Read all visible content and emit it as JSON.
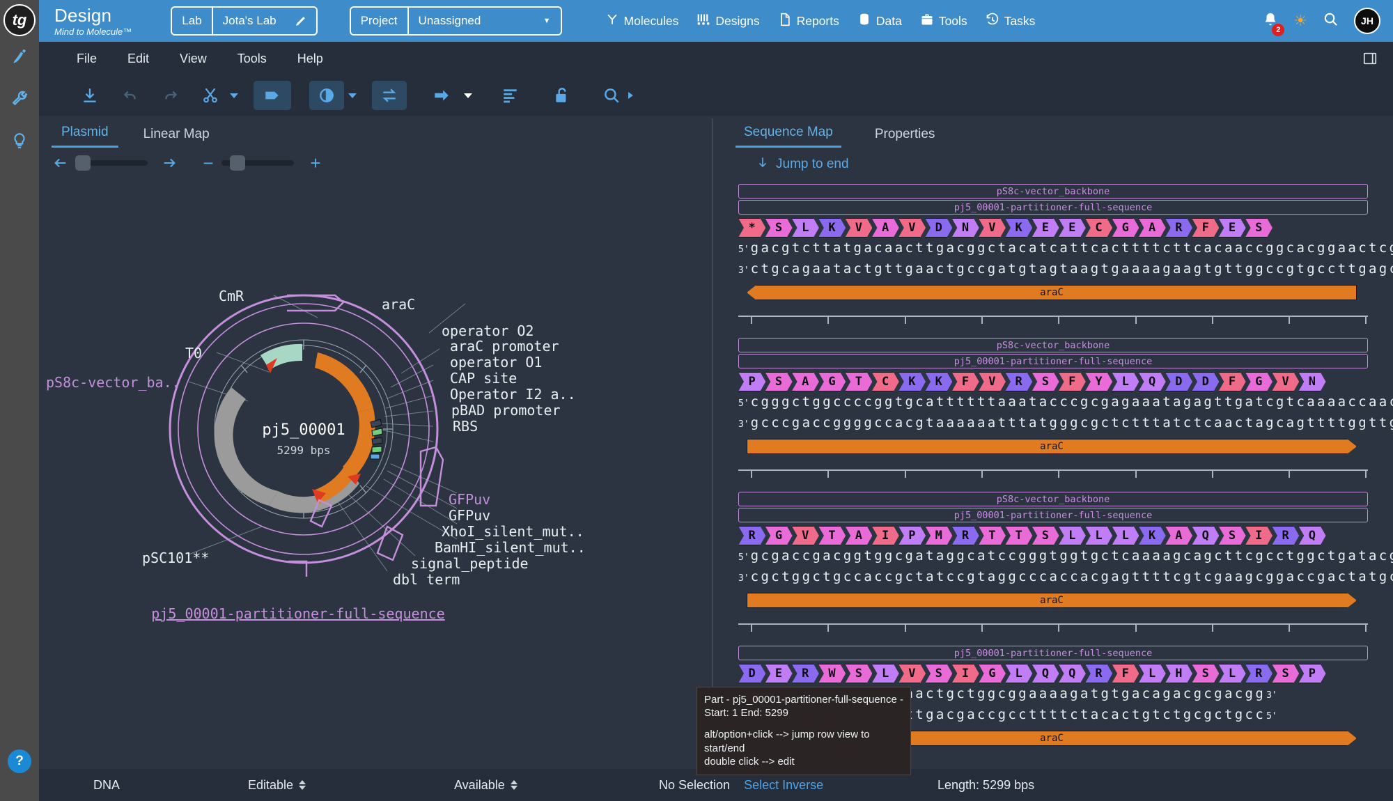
{
  "rail": {
    "logo_text": "tg",
    "icons": [
      "pen-icon",
      "wrench-icon",
      "bulb-icon"
    ],
    "help_label": "?"
  },
  "topbar": {
    "brand_title": "Design",
    "brand_tagline": "Mind to Molecule™",
    "lab": {
      "label": "Lab",
      "value": "Jota's Lab",
      "edit_icon": "pencil-icon"
    },
    "project": {
      "label": "Project",
      "value": "Unassigned",
      "caret_icon": "chevron-down-icon"
    },
    "nav": [
      {
        "label": "Molecules",
        "icon": "molecules-icon"
      },
      {
        "label": "Designs",
        "icon": "designs-icon"
      },
      {
        "label": "Reports",
        "icon": "report-page-icon"
      },
      {
        "label": "Data",
        "icon": "database-icon"
      },
      {
        "label": "Tools",
        "icon": "toolbox-icon"
      },
      {
        "label": "Tasks",
        "icon": "history-clock-icon"
      }
    ],
    "notifications": {
      "icon": "bell-icon",
      "count": "2"
    },
    "theme_icon": "sun-icon",
    "search_icon": "search-icon",
    "avatar_initials": "JH"
  },
  "menubar": {
    "items": [
      "File",
      "Edit",
      "View",
      "Tools",
      "Help"
    ],
    "panel_toggle_icon": "sidebar-panel-icon"
  },
  "toolbar": {
    "buttons": [
      {
        "name": "download-button",
        "icon": "download-icon"
      },
      {
        "name": "undo-button",
        "icon": "undo-icon"
      },
      {
        "name": "redo-button",
        "icon": "redo-icon"
      },
      {
        "name": "cut-button",
        "icon": "scissors-icon",
        "caret": true
      },
      {
        "name": "feature-button",
        "icon": "feature-arrow-icon",
        "active": true
      },
      {
        "name": "circular-button",
        "icon": "circular-plasmid-icon",
        "active": true,
        "caret": true
      },
      {
        "name": "flip-button",
        "icon": "swap-arrows-icon",
        "active": true
      },
      {
        "name": "direction-button",
        "icon": "right-arrow-icon",
        "caret": true
      },
      {
        "name": "align-button",
        "icon": "align-left-icon"
      },
      {
        "name": "unlock-button",
        "icon": "unlock-icon"
      },
      {
        "name": "find-button",
        "icon": "search-icon",
        "caret": true
      }
    ]
  },
  "left_pane": {
    "tabs": [
      {
        "label": "Plasmid",
        "active": true
      },
      {
        "label": "Linear Map",
        "active": false
      }
    ],
    "controls": {
      "prev_icon": "arrow-left-icon",
      "next_icon": "arrow-right-icon",
      "zoom_out": "−",
      "zoom_in": "+"
    },
    "plasmid": {
      "name": "pj5_00001",
      "size": "5299 bps",
      "footer_link": "pj5_00001-partitioner-full-sequence",
      "labels_left": [
        {
          "text": "CmR",
          "color": "white"
        },
        {
          "text": "T0",
          "color": "white"
        },
        {
          "text": "pS8c-vector_ba..",
          "color": "purple"
        },
        {
          "text": "pSC101**",
          "color": "white"
        }
      ],
      "labels_right": [
        {
          "text": "araC",
          "color": "white"
        },
        {
          "text": "operator O2",
          "color": "white"
        },
        {
          "text": "araC promoter",
          "color": "white"
        },
        {
          "text": "operator O1",
          "color": "white"
        },
        {
          "text": "CAP site",
          "color": "white"
        },
        {
          "text": "Operator I2 a..",
          "color": "white"
        },
        {
          "text": "pBAD promoter",
          "color": "white"
        },
        {
          "text": "RBS",
          "color": "white"
        },
        {
          "text": "GFPuv",
          "color": "purple"
        },
        {
          "text": "GFPuv",
          "color": "white"
        },
        {
          "text": "XhoI_silent_mut..",
          "color": "white"
        },
        {
          "text": "BamHI_silent_mut..",
          "color": "white"
        },
        {
          "text": "signal_peptide",
          "color": "white"
        },
        {
          "text": "dbl term",
          "color": "white"
        }
      ]
    }
  },
  "right_pane": {
    "tabs": [
      {
        "label": "Sequence Map",
        "active": true
      },
      {
        "label": "Properties",
        "active": false
      }
    ],
    "jump_to_end": {
      "label": "Jump to end",
      "icon": "arrow-down-icon"
    },
    "feature_track_1": "pS8c-vector_backbone",
    "feature_track_2": "pj5_00001-partitioner-full-sequence",
    "orf_label": "araC",
    "rows": [
      {
        "aminoacids": [
          "*",
          "S",
          "L",
          "K",
          "V",
          "A",
          "V",
          "D",
          "N",
          "V",
          "K",
          "E",
          "E",
          "C",
          "G",
          "A",
          "R",
          "F",
          "E",
          "S"
        ],
        "top_strand": "gacgtcttatgacaacttgacggctacatcattcacttttcttcacaaccggcacggaactcgct",
        "bottom_strand": "ctgcagaatactgttgaactgccgatgtagtaagtgaaaagaagtgttggccgtgccttgagcga",
        "five_prime": "5'",
        "three_prime": "3'",
        "orf_direction": "left"
      },
      {
        "aminoacids": [
          "P",
          "S",
          "A",
          "G",
          "T",
          "C",
          "K",
          "K",
          "F",
          "V",
          "R",
          "S",
          "F",
          "Y",
          "L",
          "Q",
          "D",
          "D",
          "F",
          "G",
          "V",
          "N"
        ],
        "top_strand": "cgggctggccccggtgcattttttaaatacccgcgagaaatagagttgatcgtcaaaaccaacatt",
        "bottom_strand": "gccc­gaccggggccacgtaaaaaatttatgggcgctctttatctcaactagcagttttggttgtaa",
        "five_prime": "5'",
        "three_prime": "3'",
        "orf_direction": "flat"
      },
      {
        "aminoacids": [
          "R",
          "G",
          "V",
          "T",
          "A",
          "I",
          "P",
          "M",
          "R",
          "T",
          "T",
          "S",
          "L",
          "L",
          "L",
          "K",
          "A",
          "Q",
          "S",
          "I",
          "R",
          "Q"
        ],
        "top_strand": "gcgaccgacggtggcgataggcatccgggtggtgctcaaaagcagcttcgcctggctgatacgttg",
        "bottom_strand": "cgctggctgccaccgctatccgtaggcccaccacgagttttcgtcgaagcggaccgactatgcaac",
        "five_prime": "5'",
        "three_prime": "3'",
        "orf_direction": "right"
      },
      {
        "aminoacids": [
          "D",
          "E",
          "R",
          "W",
          "S",
          "L",
          "V",
          "S",
          "I",
          "G",
          "L",
          "Q",
          "Q",
          "R",
          "F",
          "L",
          "H",
          "S",
          "L",
          "R",
          "S",
          "P"
        ],
        "top_strand": "ctgacgctaatccctaactgctggcggaaaagatgtgacagacgcgacgg",
        "bottom_strand": "gactgcgattagggattgacgaccgccttttctacactgtctgcgctgcc",
        "five_prime": "5'",
        "three_prime": "3'",
        "orf_direction": "right"
      }
    ]
  },
  "tooltip": {
    "line1": "Part - pj5_00001-partitioner-full-sequence -",
    "line2": "Start: 1 End: 5299",
    "line3": "alt/option+click --> jump row view to start/end",
    "line4": "double click --> edit"
  },
  "statusbar": {
    "molecule_type": "DNA",
    "editable": "Editable",
    "availability": "Available",
    "selection": "No Selection",
    "select_inverse": "Select Inverse",
    "length": "Length: 5299 bps"
  },
  "colors": {
    "brand_blue": "#3f8ccb",
    "accent_blue": "#5aa9e6",
    "panel_dark": "#252e3a",
    "body_dark": "#2b3440",
    "purple": "#c58fdd",
    "orange": "#e07b21",
    "aa_pink": "#f06a8a",
    "aa_magenta": "#e86bd8",
    "aa_violet": "#8a6bf0",
    "aa_lilac": "#c07df5"
  }
}
